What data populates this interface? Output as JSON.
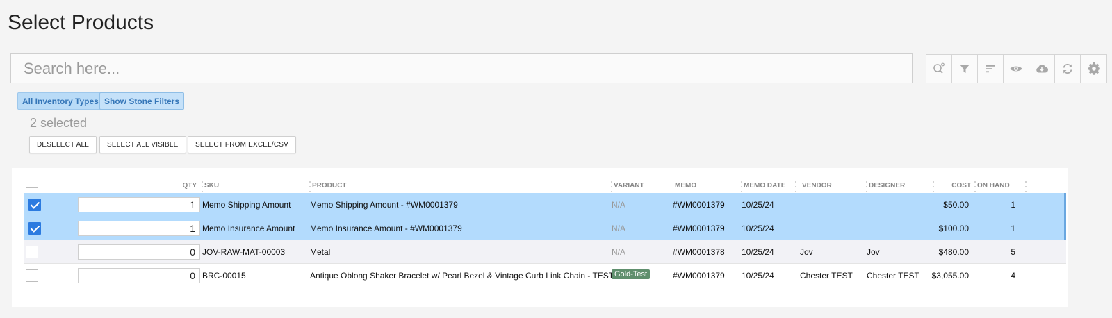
{
  "page": {
    "title": "Select Products"
  },
  "search": {
    "placeholder": "Search here..."
  },
  "toolbar": {
    "icons": [
      "search-advanced-icon",
      "filter-icon",
      "sort-icon",
      "eye-icon",
      "cloud-download-icon",
      "refresh-icon",
      "gear-icon"
    ]
  },
  "filters": {
    "inventory_types_label": "All Inventory Types",
    "stone_filters_label": "Show Stone Filters"
  },
  "selection": {
    "count_text": "2 selected",
    "deselect_all": "DESELECT ALL",
    "select_all_visible": "SELECT ALL VISIBLE",
    "select_from_excel": "SELECT FROM EXCEL/CSV"
  },
  "table": {
    "headers": {
      "qty": "QTY",
      "sku": "SKU",
      "product": "PRODUCT",
      "variant": "VARIANT",
      "memo": "MEMO",
      "memo_date": "MEMO DATE",
      "vendor": "VENDOR",
      "designer": "DESIGNER",
      "cost": "COST",
      "on_hand": "ON HAND"
    },
    "rows": [
      {
        "checked": true,
        "qty": "1",
        "sku": "Memo Shipping Amount",
        "product": "Memo Shipping Amount - #WM0001379",
        "variant": "N/A",
        "memo": "#WM0001379",
        "memo_date": "10/25/24",
        "vendor": "",
        "designer": "",
        "cost": "$50.00",
        "on_hand": "1"
      },
      {
        "checked": true,
        "qty": "1",
        "sku": "Memo Insurance Amount",
        "product": "Memo Insurance Amount - #WM0001379",
        "variant": "N/A",
        "memo": "#WM0001379",
        "memo_date": "10/25/24",
        "vendor": "",
        "designer": "",
        "cost": "$100.00",
        "on_hand": "1"
      },
      {
        "checked": false,
        "qty": "0",
        "sku": "JOV-RAW-MAT-00003",
        "product": "Metal",
        "variant": "N/A",
        "memo": "#WM0001378",
        "memo_date": "10/25/24",
        "vendor": "Jov",
        "designer": "Jov",
        "cost": "$480.00",
        "on_hand": "5"
      },
      {
        "checked": false,
        "qty": "0",
        "sku": "BRC-00015",
        "product": "Antique Oblong Shaker Bracelet w/ Pearl Bezel & Vintage Curb Link Chain - TEST",
        "variant": "Gold-Test",
        "memo": "#WM0001379",
        "memo_date": "10/25/24",
        "vendor": "Chester TEST",
        "designer": "Chester TEST",
        "cost": "$3,055.00",
        "on_hand": "4"
      }
    ]
  },
  "colors": {
    "selected_row": "#b3dbfd",
    "checkbox_checked": "#2c7be0",
    "chip_bg": "#b9dbf7",
    "variant_badge": "#5f8f6d"
  }
}
